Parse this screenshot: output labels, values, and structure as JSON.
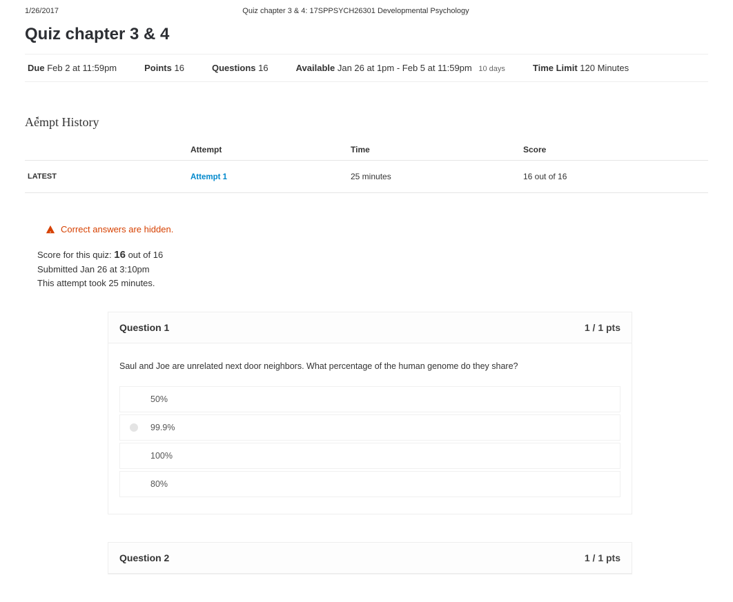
{
  "page": {
    "date": "1/26/2017",
    "header_title": "Quiz chapter 3 & 4: 17SPPSYCH26301 Developmental Psychology"
  },
  "quiz": {
    "title": "Quiz chapter 3 & 4",
    "meta": {
      "due_label": "Due",
      "due_value": "Feb 2 at 11:59pm",
      "points_label": "Points",
      "points_value": "16",
      "questions_label": "Questions",
      "questions_value": "16",
      "available_label": "Available",
      "available_value": "Jan 26 at 1pm ­- Feb 5 at 11:59pm",
      "available_sub": "10 days",
      "timelimit_label": "Time Limit",
      "timelimit_value": "120 Minutes"
    }
  },
  "attempt_history": {
    "heading": "Aܽempt History",
    "columns": {
      "c0": "",
      "c1": "Attempt",
      "c2": "Time",
      "c3": "Score"
    },
    "row": {
      "latest": "LATEST",
      "attempt": "Attempt 1",
      "time": "25 minutes",
      "score": "16 out of 16"
    }
  },
  "notice": {
    "hidden_text": "Correct answers are hidden.",
    "score_prefix": "Score for this quiz: ",
    "score_value": "16",
    "score_suffix": " out of 16",
    "submitted": "Submitted Jan 26 at 3:10pm",
    "took": "This attempt took 25 minutes."
  },
  "questions": [
    {
      "title": "Question 1",
      "pts": "1 / 1 pts",
      "text": "Saul and Joe are unrelated next door neighbors. What percentage of the human genome do they share?",
      "answers": [
        "50%",
        "99.9%",
        "100%",
        "80%"
      ],
      "selected_index": 1
    },
    {
      "title": "Question 2",
      "pts": "1 / 1 pts"
    }
  ]
}
